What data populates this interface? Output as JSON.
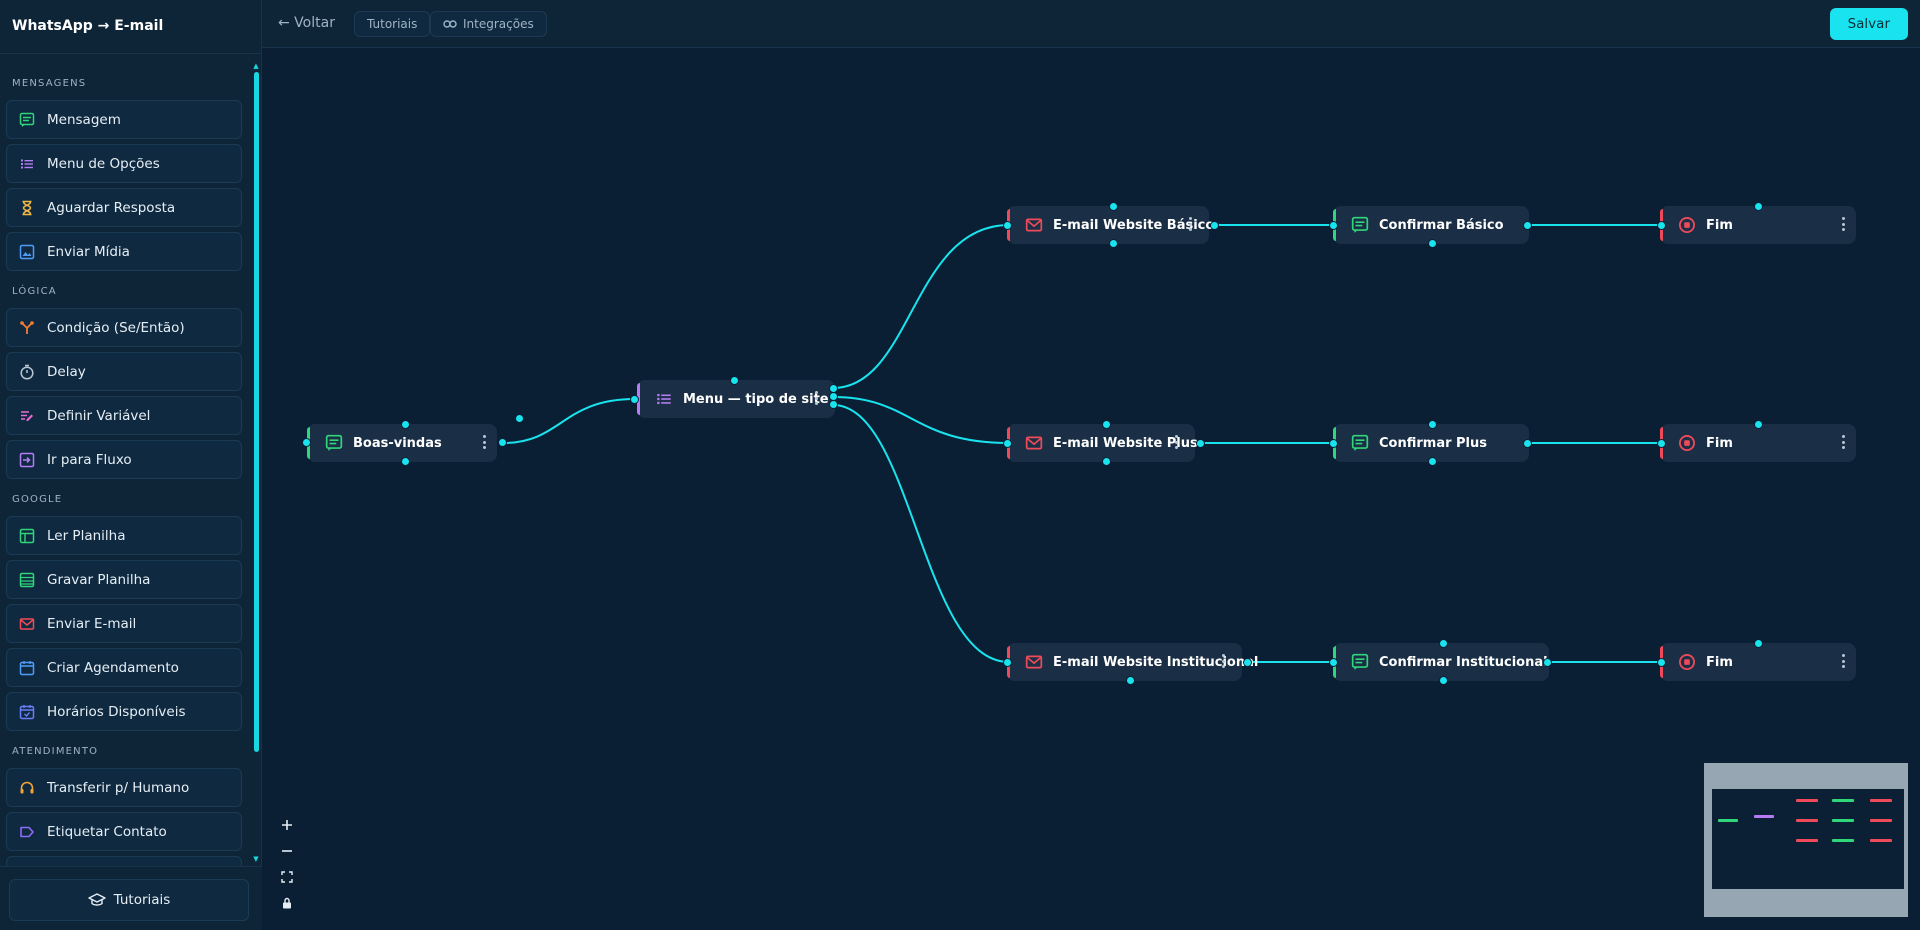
{
  "app": {
    "title": "WhatsApp → E-mail"
  },
  "topbar": {
    "back_label": "← Voltar",
    "tutorials_label": "Tutoriais",
    "integrations_label": "Integrações",
    "save_label": "Salvar"
  },
  "sidebar": {
    "sections": [
      {
        "label": "Mensagens",
        "items": [
          {
            "label": "Mensagem",
            "icon": "message-icon",
            "color": "#2fd67a"
          },
          {
            "label": "Menu de Opções",
            "icon": "list-icon",
            "color": "#b67cf5"
          },
          {
            "label": "Aguardar Resposta",
            "icon": "hourglass-icon",
            "color": "#f3b844"
          },
          {
            "label": "Enviar Mídia",
            "icon": "image-icon",
            "color": "#4f9cf7"
          }
        ]
      },
      {
        "label": "Lógica",
        "items": [
          {
            "label": "Condição (Se/Então)",
            "icon": "branch-icon",
            "color": "#f47c36"
          },
          {
            "label": "Delay",
            "icon": "timer-icon",
            "color": "#b8c7d4"
          },
          {
            "label": "Definir Variável",
            "icon": "variable-icon",
            "color": "#e76cd1"
          },
          {
            "label": "Ir para Fluxo",
            "icon": "goto-icon",
            "color": "#b67cf5"
          }
        ]
      },
      {
        "label": "Google",
        "items": [
          {
            "label": "Ler Planilha",
            "icon": "sheet-read-icon",
            "color": "#2fd67a"
          },
          {
            "label": "Gravar Planilha",
            "icon": "sheet-write-icon",
            "color": "#2fd67a"
          },
          {
            "label": "Enviar E-mail",
            "icon": "mail-icon",
            "color": "#ef4a5a"
          },
          {
            "label": "Criar Agendamento",
            "icon": "calendar-icon",
            "color": "#4f9cf7"
          },
          {
            "label": "Horários Disponíveis",
            "icon": "calendar-check-icon",
            "color": "#6b7cf7"
          }
        ]
      },
      {
        "label": "Atendimento",
        "items": [
          {
            "label": "Transferir p/ Humano",
            "icon": "headset-icon",
            "color": "#f4a236"
          },
          {
            "label": "Etiquetar Contato",
            "icon": "tag-icon",
            "color": "#8a6cf5"
          }
        ]
      }
    ],
    "footer": {
      "tutorials_label": "Tutoriais"
    }
  },
  "flow": {
    "nodes": [
      {
        "id": "boas",
        "label": "Boas-vindas",
        "type": "message",
        "color": "#2fd67a"
      },
      {
        "id": "menu",
        "label": "Menu — tipo de site",
        "type": "menu",
        "color": "#b67cf5"
      },
      {
        "id": "e1",
        "label": "E-mail Website Básico",
        "type": "mail",
        "color": "#ef4a5a"
      },
      {
        "id": "c1",
        "label": "Confirmar Básico",
        "type": "message",
        "color": "#2fd67a"
      },
      {
        "id": "f1",
        "label": "Fim",
        "type": "end",
        "color": "#ef4a5a"
      },
      {
        "id": "e2",
        "label": "E-mail Website Plus",
        "type": "mail",
        "color": "#ef4a5a"
      },
      {
        "id": "c2",
        "label": "Confirmar Plus",
        "type": "message",
        "color": "#2fd67a"
      },
      {
        "id": "f2",
        "label": "Fim",
        "type": "end",
        "color": "#ef4a5a"
      },
      {
        "id": "e3",
        "label": "E-mail Website Institucional",
        "type": "mail",
        "color": "#ef4a5a"
      },
      {
        "id": "c3",
        "label": "Confirmar Institucional",
        "type": "message",
        "color": "#2fd67a"
      },
      {
        "id": "f3",
        "label": "Fim",
        "type": "end",
        "color": "#ef4a5a"
      }
    ]
  },
  "colors": {
    "accent": "#19e3ee",
    "edge": "#19e3ee",
    "canvas": "#0a1f33"
  }
}
